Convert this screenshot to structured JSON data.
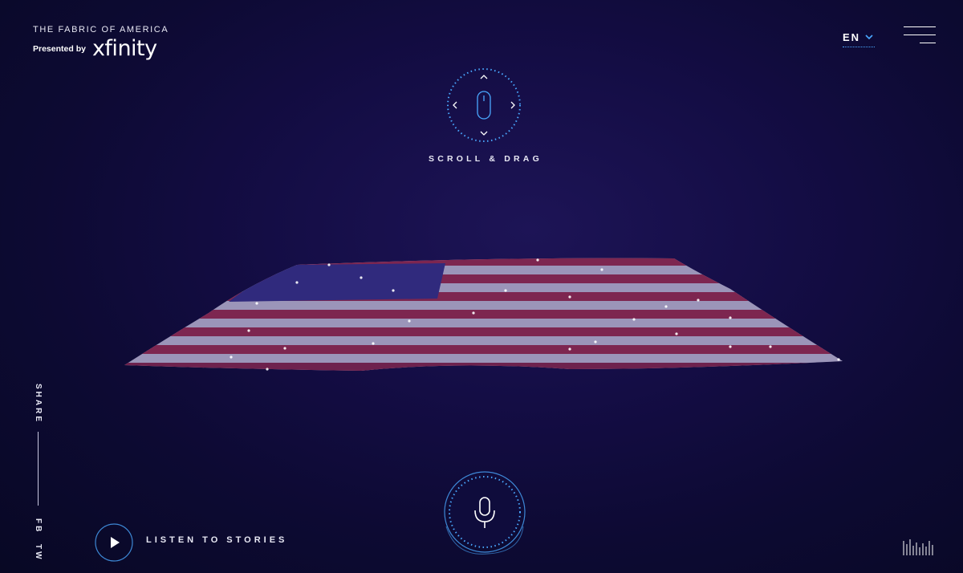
{
  "brand": {
    "title": "THE FABRIC OF AMERICA",
    "presented_by": "Presented by",
    "logo": "xfinity"
  },
  "header": {
    "language": "EN",
    "language_icon": "chevron-down-icon",
    "menu_icon": "hamburger-menu-icon"
  },
  "hint": {
    "label": "SCROLL & DRAG",
    "icon": "mouse-icon"
  },
  "listen": {
    "label": "LISTEN TO STORIES",
    "icon": "play-icon"
  },
  "mic": {
    "icon": "microphone-icon"
  },
  "share": {
    "label": "SHARE",
    "fb": "FB",
    "tw": "TW"
  },
  "sound": {
    "icon": "sound-bars-icon"
  },
  "colors": {
    "accent": "#4aa8ff",
    "background": "#140d45",
    "flag_red": "#b8345a",
    "flag_blue": "#2a2a7a"
  }
}
